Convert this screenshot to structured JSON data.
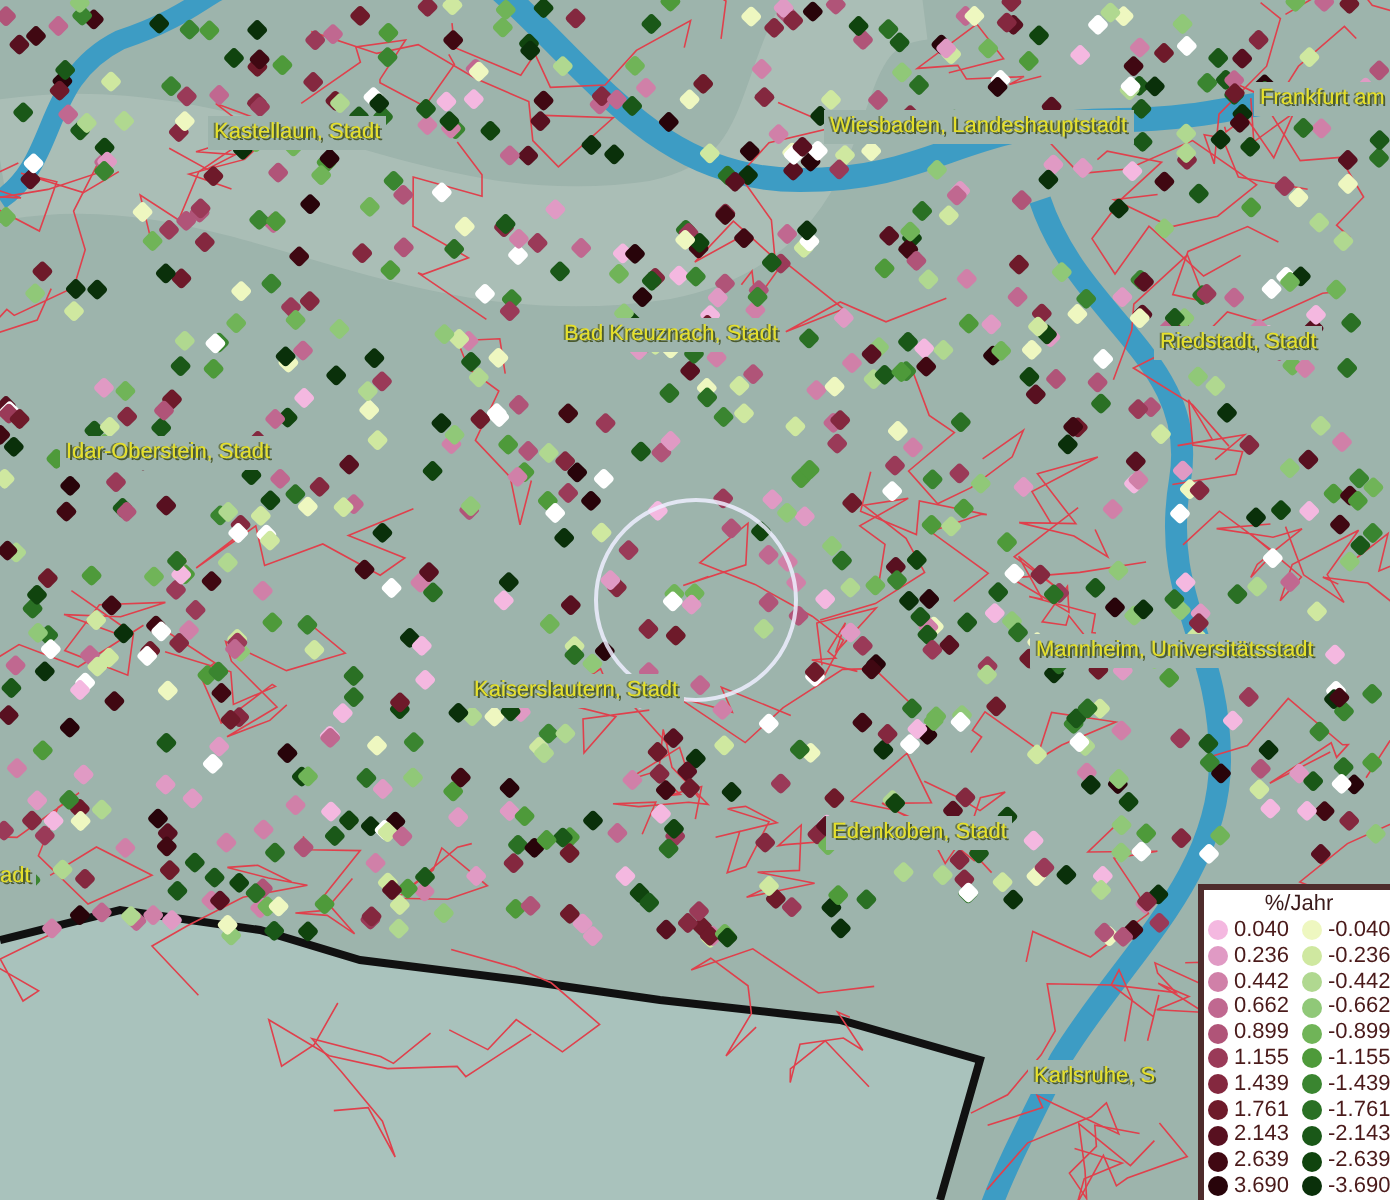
{
  "map": {
    "labels": [
      {
        "text": "Frankfurt am"
      },
      {
        "text": "Kastellaun, Stadt"
      },
      {
        "text": "Wiesbaden, Landeshauptstadt"
      },
      {
        "text": "Bad Kreuznach, Stadt"
      },
      {
        "text": "Riedstadt, Stadt"
      },
      {
        "text": "Idar-Oberstein, Stadt"
      },
      {
        "text": "Mannheim, Universitätsstadt"
      },
      {
        "text": "Kaiserslautern, Stadt"
      },
      {
        "text": "Edenkoben, Stadt"
      },
      {
        "text": "adt"
      },
      {
        "text": "Karlsruhe, S"
      }
    ]
  },
  "legend": {
    "title": "%/Jahr",
    "positive": [
      {
        "value": "0.040",
        "color": "#f4b8e0"
      },
      {
        "value": "0.236",
        "color": "#e09ac4"
      },
      {
        "value": "0.442",
        "color": "#d080a8"
      },
      {
        "value": "0.662",
        "color": "#c06890"
      },
      {
        "value": "0.899",
        "color": "#b05478"
      },
      {
        "value": "1.155",
        "color": "#9a3a58"
      },
      {
        "value": "1.439",
        "color": "#84283f"
      },
      {
        "value": "1.761",
        "color": "#6e1a2a"
      },
      {
        "value": "2.143",
        "color": "#581020"
      },
      {
        "value": "2.639",
        "color": "#400812"
      },
      {
        "value": "3.690",
        "color": "#28040a"
      }
    ],
    "negative": [
      {
        "value": "-0.040",
        "color": "#eef7c0"
      },
      {
        "value": "-0.236",
        "color": "#cfe8a0"
      },
      {
        "value": "-0.442",
        "color": "#b0d890"
      },
      {
        "value": "-0.662",
        "color": "#90c878"
      },
      {
        "value": "-0.899",
        "color": "#70b458"
      },
      {
        "value": "-1.155",
        "color": "#4e9a3a"
      },
      {
        "value": "-1.439",
        "color": "#3a8530"
      },
      {
        "value": "-1.761",
        "color": "#2a7024"
      },
      {
        "value": "-2.143",
        "color": "#1a5818"
      },
      {
        "value": "-2.639",
        "color": "#10440e"
      },
      {
        "value": "-3.690",
        "color": "#0a300a"
      }
    ]
  }
}
